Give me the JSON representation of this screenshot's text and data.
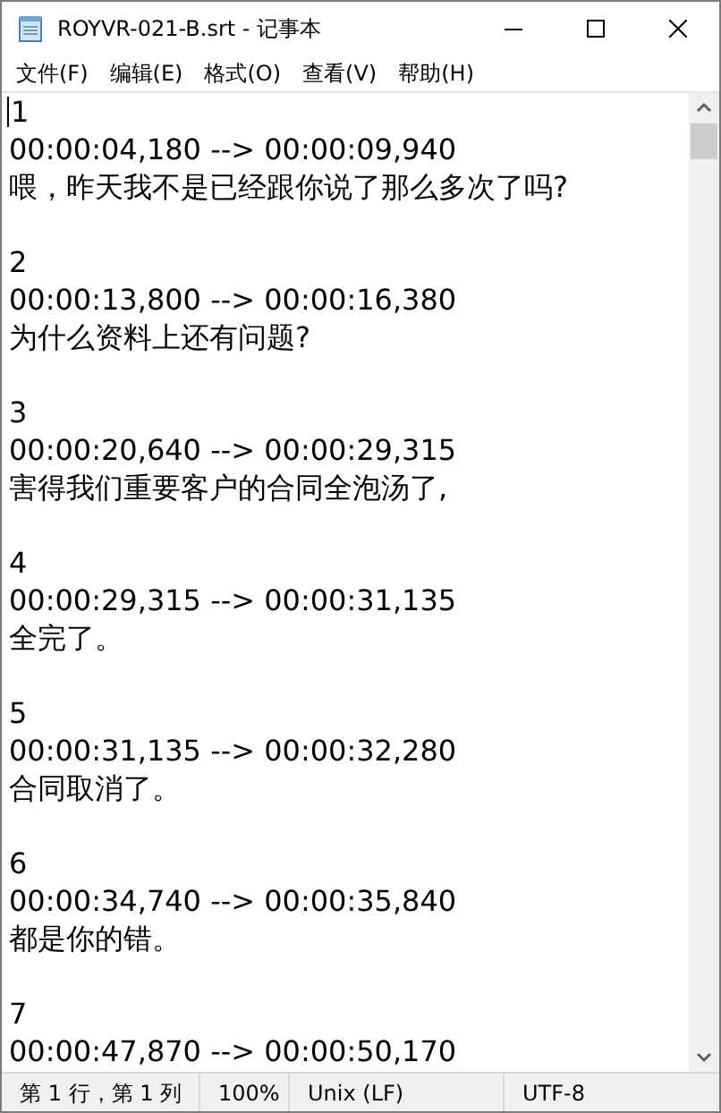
{
  "window": {
    "title": "ROYVR-021-B.srt - 记事本"
  },
  "menu": [
    "文件(F)",
    "编辑(E)",
    "格式(O)",
    "查看(V)",
    "帮助(H)"
  ],
  "entries": [
    {
      "index": "1",
      "time": "00:00:04,180 --> 00:00:09,940",
      "text": "喂，昨天我不是已经跟你说了那么多次了吗?"
    },
    {
      "index": "2",
      "time": "00:00:13,800 --> 00:00:16,380",
      "text": "为什么资料上还有问题?"
    },
    {
      "index": "3",
      "time": "00:00:20,640 --> 00:00:29,315",
      "text": "害得我们重要客户的合同全泡汤了,"
    },
    {
      "index": "4",
      "time": "00:00:29,315 --> 00:00:31,135",
      "text": "全完了。"
    },
    {
      "index": "5",
      "time": "00:00:31,135 --> 00:00:32,280",
      "text": "合同取消了。"
    },
    {
      "index": "6",
      "time": "00:00:34,740 --> 00:00:35,840",
      "text": "都是你的错。"
    },
    {
      "index": "7",
      "time": "00:00:47,870 --> 00:00:50,170"
    }
  ],
  "status_bar": [
    "第 1 行，第 1 列",
    "100%",
    "Unix (LF)",
    "UTF-8"
  ]
}
